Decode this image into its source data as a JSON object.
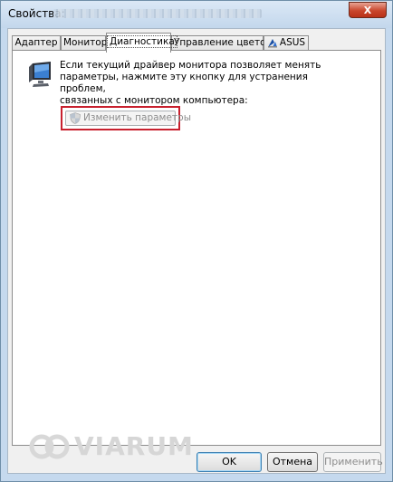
{
  "window": {
    "title": "Свойства:",
    "close_label": "X"
  },
  "tabs": [
    {
      "label": "Адаптер",
      "active": false
    },
    {
      "label": "Монитор",
      "active": false
    },
    {
      "label": "Диагностика",
      "active": true
    },
    {
      "label": "Управление цветом",
      "active": false
    },
    {
      "label": "ASUS",
      "active": false
    }
  ],
  "diagnostics": {
    "description": "Если текущий драйвер монитора позволяет менять\nпараметры, нажмите эту кнопку для устранения проблем,\nсвязанных с монитором компьютера:",
    "change_button": "Изменить параметры",
    "change_button_enabled": false
  },
  "watermark": {
    "text": "VIARUM"
  },
  "buttons": {
    "ok": "OK",
    "cancel": "Отмена",
    "apply": "Применить"
  },
  "colors": {
    "highlight": "#c8202e",
    "title_bar": "#c5d9ee"
  },
  "icons": {
    "monitor": "monitor-icon",
    "shield": "shield-icon",
    "asus_tab": "asus-icon"
  }
}
